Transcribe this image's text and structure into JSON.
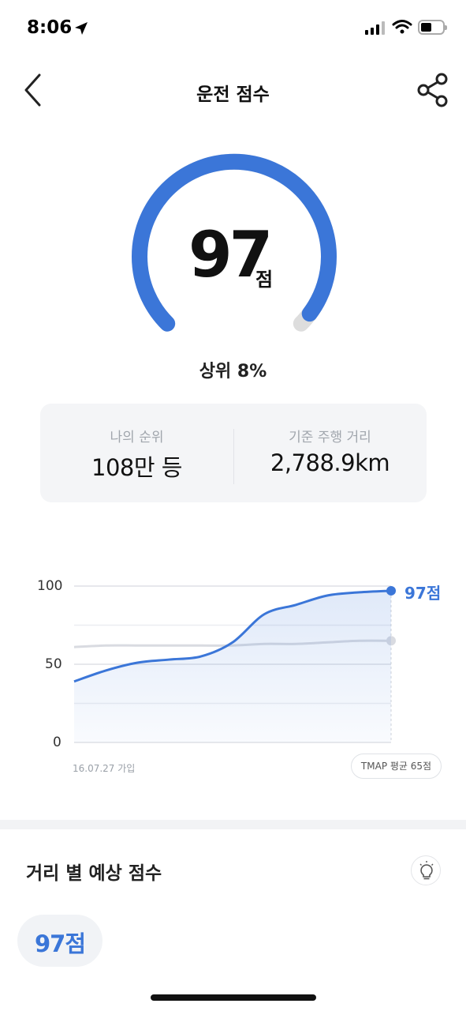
{
  "status_bar": {
    "time": "8:06"
  },
  "header": {
    "title": "운전 점수"
  },
  "gauge": {
    "score": "97",
    "unit": "점",
    "score_value": 97,
    "score_max": 100,
    "rank_text": "상위 8%"
  },
  "stats": {
    "rank_label": "나의 순위",
    "rank_value": "108만 등",
    "distance_label": "기준 주행 거리",
    "distance_value": "2,788.9km"
  },
  "chart_data": {
    "type": "line",
    "y_ticks": [
      "100",
      "50",
      "0"
    ],
    "ylim": [
      0,
      100
    ],
    "x_start_label": "16.07.27 가입",
    "end_label": "97점",
    "average_label": "TMAP 평균 65점",
    "grid": true,
    "series": [
      {
        "values": [
          39,
          46,
          51,
          53,
          55,
          64,
          82,
          88,
          94,
          96,
          97
        ],
        "color": "#3b76d8"
      },
      {
        "values": [
          61,
          62,
          62,
          62,
          62,
          62,
          63,
          63,
          64,
          65,
          65
        ],
        "color": "#d9dbe1"
      }
    ]
  },
  "distance_section": {
    "title": "거리 별 예상 점수",
    "score_chip": "97점"
  },
  "colors": {
    "accent": "#3b76d8",
    "track": "#dddddd",
    "card_bg": "#f4f5f7"
  }
}
